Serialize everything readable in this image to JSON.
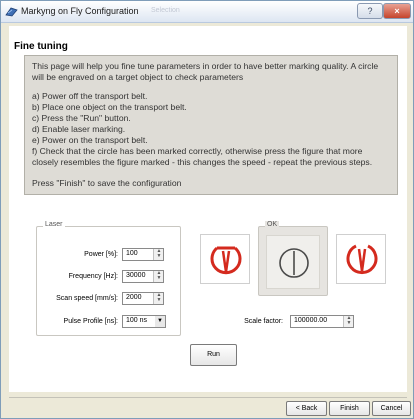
{
  "window": {
    "title": "Markyng on Fly Configuration",
    "ghost_tab": "Selection",
    "help_label": "?",
    "close_label": "×"
  },
  "page": {
    "title": "Fine tuning",
    "intro_lines": [
      "This page will help you fine tune parameters in order to have better marking quality. A circle",
      "will be engraved on a target object to check parameters"
    ],
    "steps": [
      "a) Power off the transport belt.",
      "b) Place one object on the transport belt.",
      "c) Press the \"Run\" button.",
      "d) Enable laser marking.",
      "e) Power on the transport belt.",
      "f) Check that the circle has been marked correctly, otherwise press the figure that more",
      "closely resembles the figure marked - this changes the speed - repeat the previous steps."
    ],
    "finish_note": "Press \"Finish\" to save the configuration"
  },
  "laser": {
    "group_label": "Laser",
    "power_label": "Power [%]:",
    "power_value": "100",
    "frequency_label": "Frequency [Hz]:",
    "frequency_value": "30000",
    "scan_speed_label": "Scan speed [mm/s]:",
    "scan_speed_value": "2000",
    "pulse_profile_label": "Pulse Profile [ns]:",
    "pulse_profile_value": "100 ns"
  },
  "figures": {
    "ok_group_label": "OK",
    "colors": {
      "bad": "#d42a1e",
      "ok": "#4a4a4a"
    }
  },
  "scale": {
    "label": "Scale factor:",
    "value": "100000.00"
  },
  "buttons": {
    "run": "Run",
    "back": "< Back",
    "finish": "Finish",
    "cancel": "Cancel"
  }
}
